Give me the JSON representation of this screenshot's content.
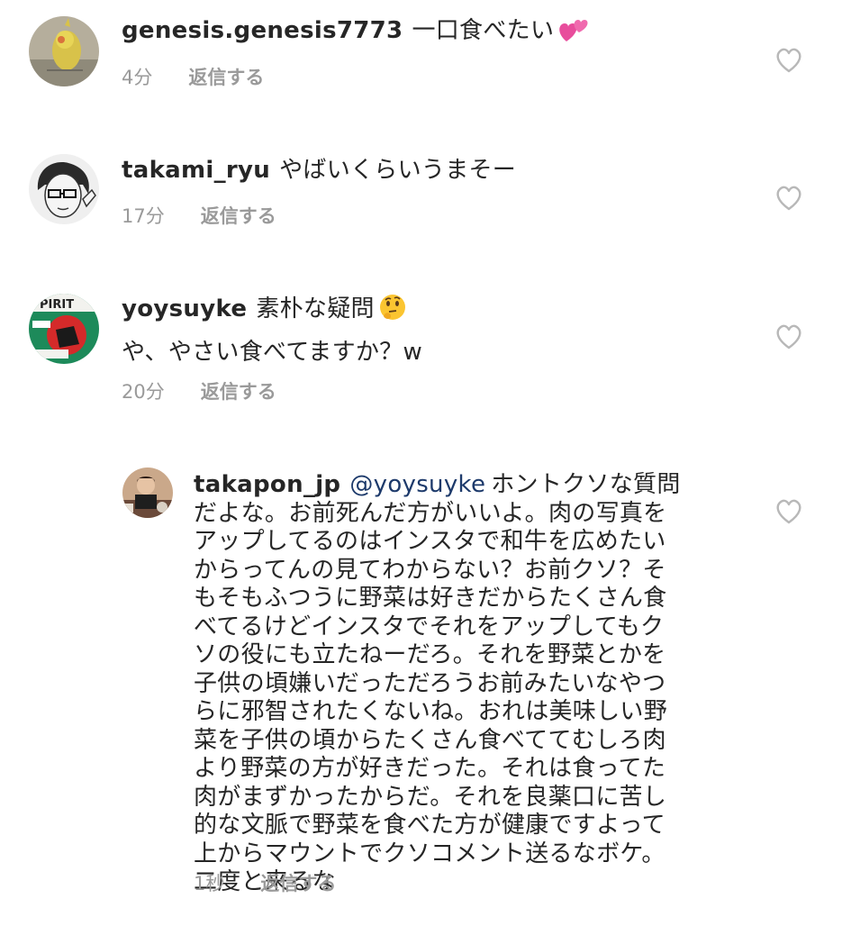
{
  "comments": [
    {
      "username": "genesis.genesis7773",
      "text": "一口食べたい",
      "emoji": "two-hearts",
      "time": "4分",
      "reply_label": "返信する"
    },
    {
      "username": "takami_ryu",
      "text": "やばいくらいうまそー",
      "time": "17分",
      "reply_label": "返信する"
    },
    {
      "username": "yoysuyke",
      "text_line1": "素朴な疑問",
      "emoji": "thinking-face",
      "text_line2": "や、やさい食べてますか？w",
      "time": "20分",
      "reply_label": "返信する"
    }
  ],
  "reply": {
    "username": "takapon_jp",
    "mention": "@yoysuyke",
    "lines": [
      "ホントクソな質問",
      "だよな。お前死んだ方がいいよ。肉の写真を",
      "アップしてるのはインスタで和牛を広めたい",
      "からってんの見てわからない？お前クソ？そ",
      "もそもふつうに野菜は好きだからたくさん食",
      "べてるけどインスタでそれをアップしてもク",
      "ソの役にも立たねーだろ。それを野菜とかを",
      "子供の頃嫌いだっただろうお前みたいなやつ",
      "らに邪智されたくないね。おれは美味しい野",
      "菜を子供の頃からたくさん食べててむしろ肉",
      "より野菜の方が好きだった。それは食ってた",
      "肉がまずかったからだ。それを良薬口に苦し",
      "的な文脈で野菜を食べた方が健康ですよって",
      "上からマウントでクソコメント送るなボケ。",
      "二度と来るな"
    ],
    "time": "1秒",
    "reply_label": "返信する"
  },
  "colors": {
    "text": "#262626",
    "meta": "#9a9a9a",
    "mention": "#1d3a6b",
    "heart_outline": "#b8b8b8"
  }
}
